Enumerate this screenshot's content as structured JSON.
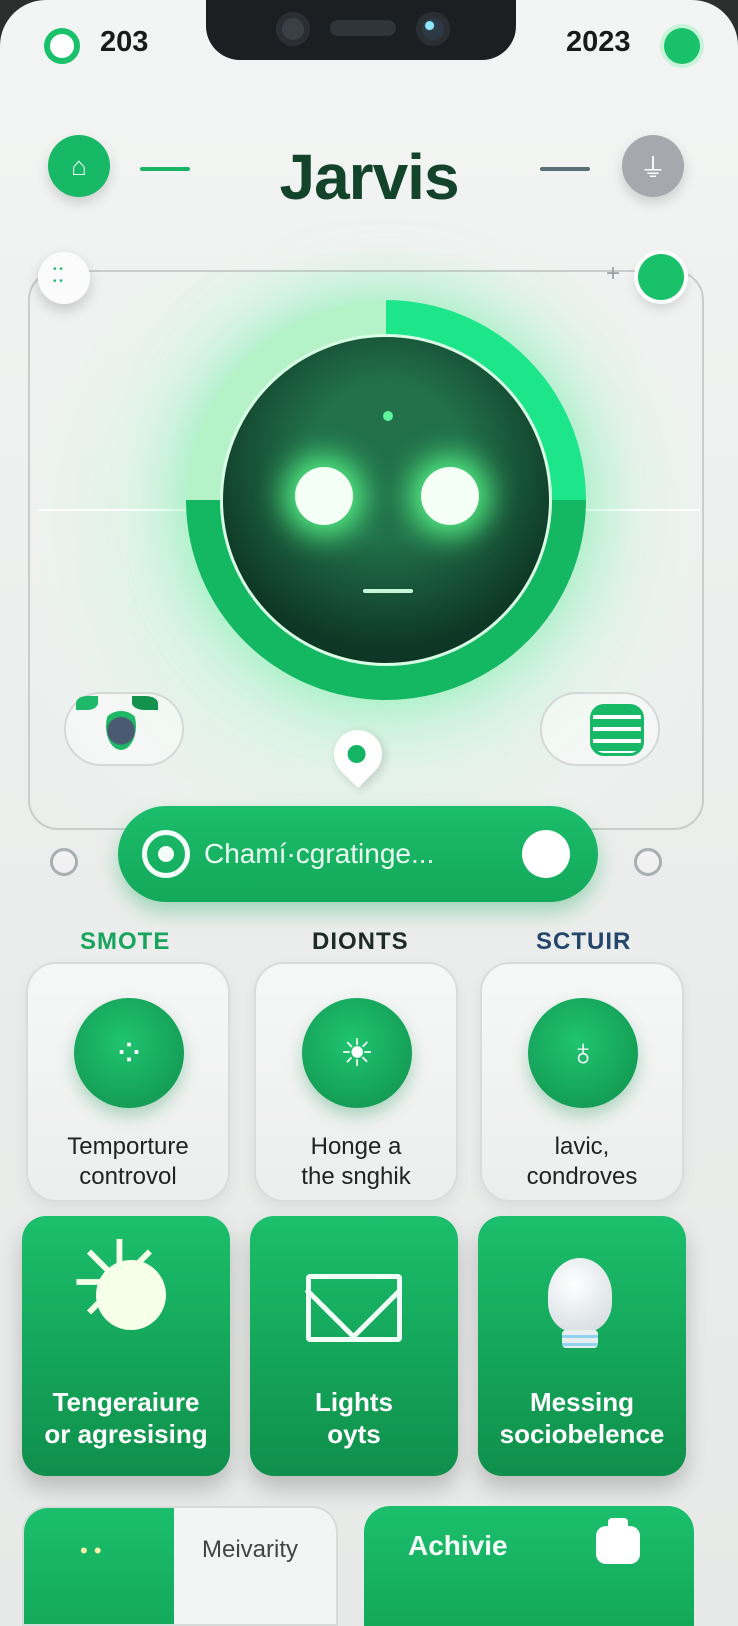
{
  "status_bar": {
    "left_text": "203",
    "right_text": "2023"
  },
  "header": {
    "title": "Jarvis"
  },
  "assistant": {
    "status_pill_text": "Chamí·cgratinge..."
  },
  "categories": [
    "SMOTE",
    "DIONTS",
    "SCTUIR"
  ],
  "cards": [
    {
      "label": "Temporture\ncontrovol",
      "icon": "dial-icon"
    },
    {
      "label": "Honge a\nthe snghik",
      "icon": "lamp-icon"
    },
    {
      "label": "lavic,\ncondroves",
      "icon": "bag-icon"
    }
  ],
  "tiles": [
    {
      "label": "Tengeraiure\nor agresising",
      "icon": "sun-icon"
    },
    {
      "label": "Lights\noyts",
      "icon": "envelope-icon"
    },
    {
      "label": "Messing\nsociobelence",
      "icon": "bulb-icon"
    }
  ],
  "bottom": {
    "left_text": "Meivarity",
    "right_text": "Achivie"
  },
  "colors": {
    "accent": "#19c26a",
    "dark_green": "#14432c",
    "background": "#eef0ef"
  }
}
